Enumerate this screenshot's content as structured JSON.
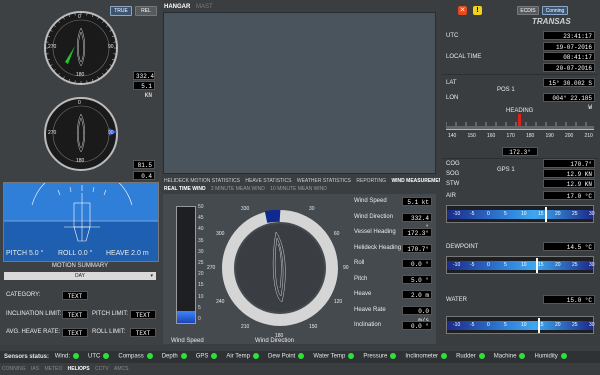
{
  "top_left": {
    "true_btn": "TRUE",
    "rel_btn": "REL",
    "heading_readout": "332.4 °",
    "speed1_readout": "5.1 KN",
    "heading2_readout": "81.5 °",
    "speed2_readout": "0.4 KN"
  },
  "compass1_ticks": [
    "0",
    "90",
    "180",
    "270"
  ],
  "compass2_ticks": [
    "0",
    "90",
    "180",
    "270"
  ],
  "attitude": {
    "pitch": "PITCH 5.0 °",
    "roll": "ROLL 0.0 °",
    "heave": "HEAVE 2.0 m"
  },
  "motion_summary": {
    "title": "MOTION SUMMARY",
    "select_value": "DAY"
  },
  "limits": {
    "category_label": "CATEGORY:",
    "category_value": "TEXT",
    "incl_label": "INCLINATION LIMIT:",
    "incl_value": "TEXT",
    "pitch_label": "PITCH LIMIT:",
    "pitch_value": "TEXT",
    "heave_label": "AVG. HEAVE RATE:",
    "heave_value": "TEXT",
    "roll_label": "ROLL LIMIT:",
    "roll_value": "TEXT"
  },
  "center_tabs": [
    "HANGAR",
    "MAST"
  ],
  "stats_tabs": [
    "HELIDECK MOTION STATISTICS",
    "HEAVE STATISTICS",
    "WEATHER STATISTICS",
    "REPORTING",
    "WIND MEASUREMENT"
  ],
  "wind_tabs": [
    "REAL TIME WIND",
    "2 MINUTE MEAN WIND",
    "10 MINUTE MEAN WIND"
  ],
  "wind_speed_scale": [
    "50",
    "45",
    "40",
    "35",
    "30",
    "25",
    "20",
    "15",
    "10",
    "5",
    "0"
  ],
  "wind_speed_value": 5.1,
  "wind_dir_ticks": [
    "30",
    "60",
    "90",
    "120",
    "150",
    "180",
    "210",
    "240",
    "270",
    "300",
    "330"
  ],
  "wind_labels": {
    "speed": "Wind Speed",
    "direction": "Wind Direction"
  },
  "wind_readouts": [
    {
      "label": "Wind Speed",
      "value": "5.1 kt"
    },
    {
      "label": "Wind Direction",
      "value": "332.4 °"
    },
    {
      "label": "Vessel Heading",
      "value": "172.3°"
    },
    {
      "label": "Helideck Heading",
      "value": "170.7°"
    },
    {
      "label": "Roll",
      "value": "0.0 °"
    },
    {
      "label": "Pitch",
      "value": "5.0 °"
    },
    {
      "label": "Heave",
      "value": "2.0 m"
    },
    {
      "label": "Heave Rate",
      "value": "0.0 m/s"
    },
    {
      "label": "Inclination",
      "value": "0.0 °"
    }
  ],
  "right": {
    "ecdis_btn": "ECDIS",
    "conning_btn": "Conning",
    "brand": "TRANSAS",
    "utc_label": "UTC",
    "utc_time": "23:41:17",
    "utc_date": "19-07-2016",
    "local_label": "LOCAL TIME",
    "local_time": "08:41:17",
    "local_date": "20-07-2016",
    "lat_label": "LAT",
    "lat_value": "15° 30.002 S",
    "pos_label": "POS 1",
    "lon_label": "LON",
    "lon_value": "004° 22.185 W",
    "heading_label": "HEADING",
    "heading_ticks": [
      "140",
      "150",
      "160",
      "170",
      "180",
      "190",
      "200",
      "210"
    ],
    "heading_value": "172.3°",
    "cog_label": "COG",
    "cog_value": "170.7°",
    "gps_label": "GPS 1",
    "sog_label": "SOG",
    "sog_value": "12.9 KN",
    "stw_label": "STW",
    "stw_value": "12.9 KN",
    "air_label": "AIR",
    "air_value": "17.0 °C",
    "dew_label": "DEWPOINT",
    "dew_value": "14.5 °C",
    "water_label": "WATER",
    "water_value": "15.0 °C",
    "temp_ticks": [
      "-10",
      "-5",
      "0",
      "5",
      "10",
      "15",
      "20",
      "25",
      "30"
    ]
  },
  "sensors": {
    "title": "Sensors status:",
    "items": [
      "Wind:",
      "UTC",
      "Compass",
      "Depth",
      "GPS",
      "Air Temp",
      "Dew Point",
      "Water Temp",
      "Pressure",
      "Inclinometer",
      "Rudder",
      "Machine",
      "Humidity"
    ]
  },
  "bottom_tabs": [
    "CONNING",
    "IAS",
    "METEO",
    "HELIOPS",
    "CCTV",
    "AMCS"
  ],
  "colors": {
    "ok": "#2fe03a",
    "accent": "#1e5bd6",
    "sky": "#2f7fd9"
  }
}
